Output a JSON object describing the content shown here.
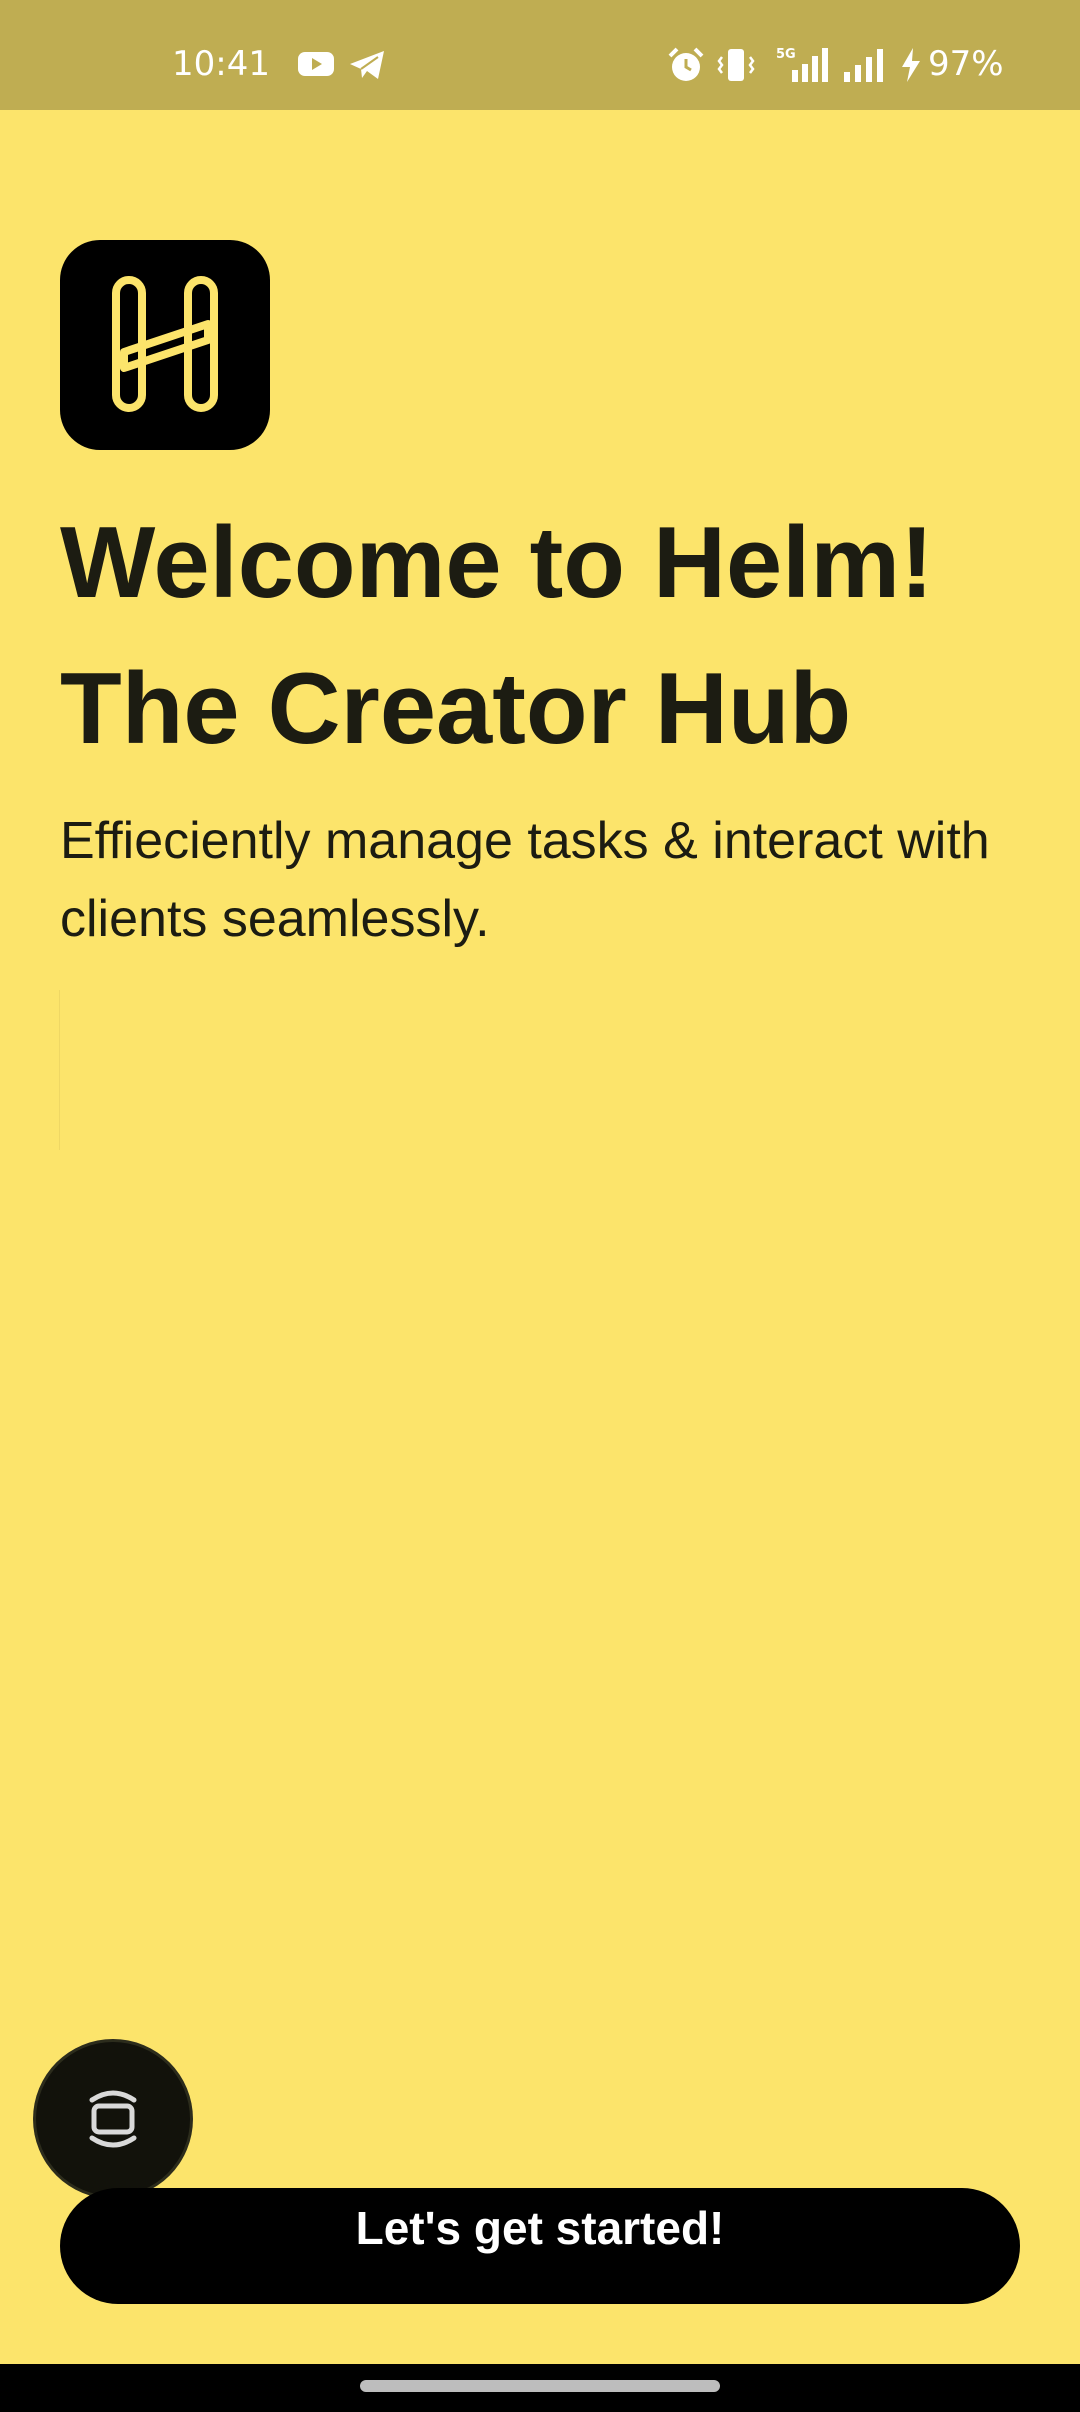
{
  "status_bar": {
    "time": "10:41",
    "network": "5G",
    "battery": "97%",
    "notification_icons": [
      "youtube-icon",
      "telegram-icon"
    ],
    "system_icons": [
      "alarm-icon",
      "vibrate-icon",
      "signal-5g-icon",
      "signal-icon",
      "charging-icon"
    ]
  },
  "logo": {
    "icon": "helm-logo-icon",
    "letter": "H",
    "background": "#000000",
    "accent": "#FCE46B"
  },
  "welcome": {
    "headline": "Welcome to Helm! The Creator Hub",
    "subtitle": "Effieciently manage tasks & interact with clients seamlessly."
  },
  "floating_action": {
    "icon": "screen-capture-icon"
  },
  "cta": {
    "label": "Let's get started!"
  },
  "theme": {
    "background": "#FCE46B",
    "status_bar": "#BFAD52",
    "button": "#000000",
    "text": "#1c1c12"
  }
}
